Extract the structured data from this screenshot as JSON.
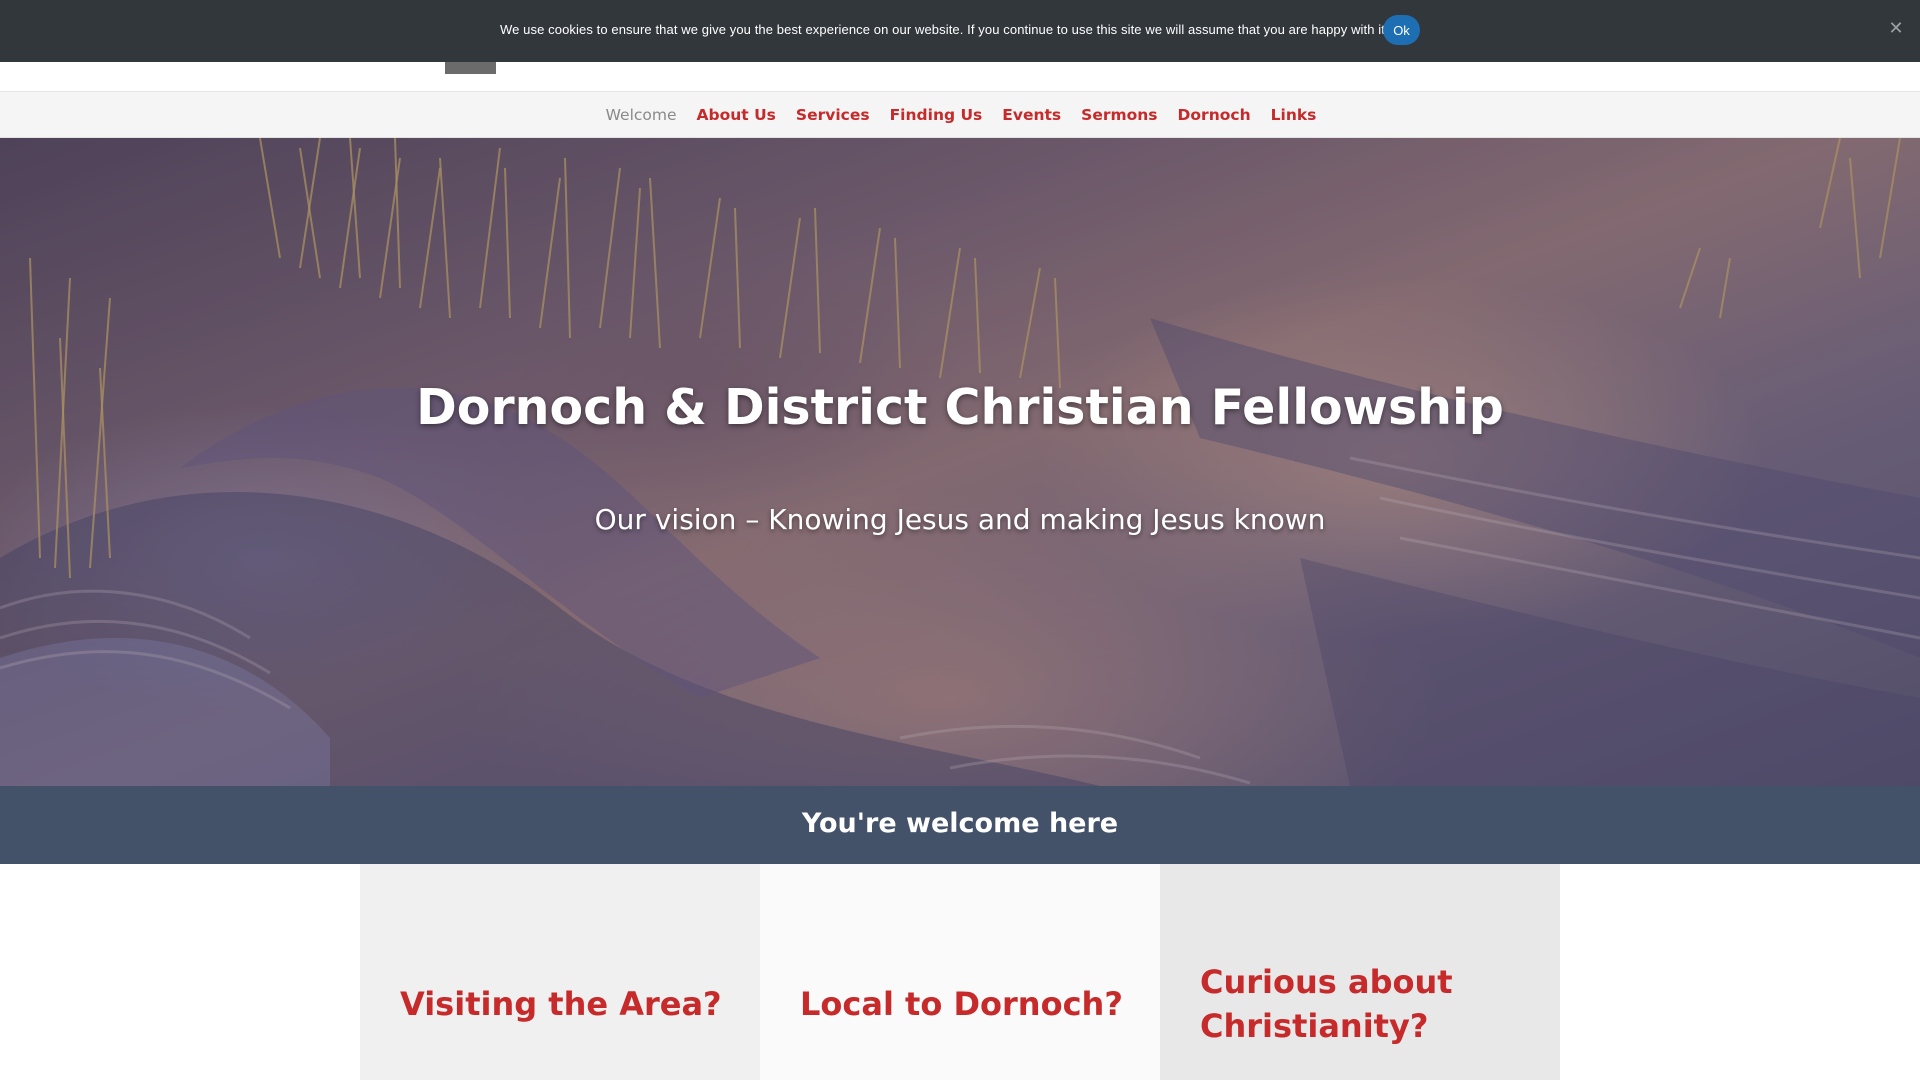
{
  "cookie_notice": {
    "text": "We use cookies to ensure that we give you the best experience on our website. If you continue to use this site we will assume that you are happy with it.",
    "ok_label": "Ok",
    "close_glyph": "✕"
  },
  "nav": {
    "items": [
      {
        "label": "Welcome",
        "active": true
      },
      {
        "label": "About Us"
      },
      {
        "label": "Services"
      },
      {
        "label": "Finding Us"
      },
      {
        "label": "Events"
      },
      {
        "label": "Sermons"
      },
      {
        "label": "Dornoch"
      },
      {
        "label": "Links"
      }
    ]
  },
  "hero": {
    "title": "Dornoch & District Christian Fellowship",
    "subtitle": "Our vision – Knowing Jesus and making Jesus known"
  },
  "welcome": {
    "heading": "You're welcome here"
  },
  "cards": [
    {
      "title": "Visiting the Area?"
    },
    {
      "title": "Local to Dornoch?"
    },
    {
      "title": "Curious about Christianity?"
    }
  ],
  "colors": {
    "cookie_bar": "#32373c",
    "cookie_button": "#1e6eb4",
    "nav_link": "#c62a2a",
    "nav_active": "#8a8a8a",
    "welcome_band": "#435269",
    "card_title": "#c62a2a"
  }
}
